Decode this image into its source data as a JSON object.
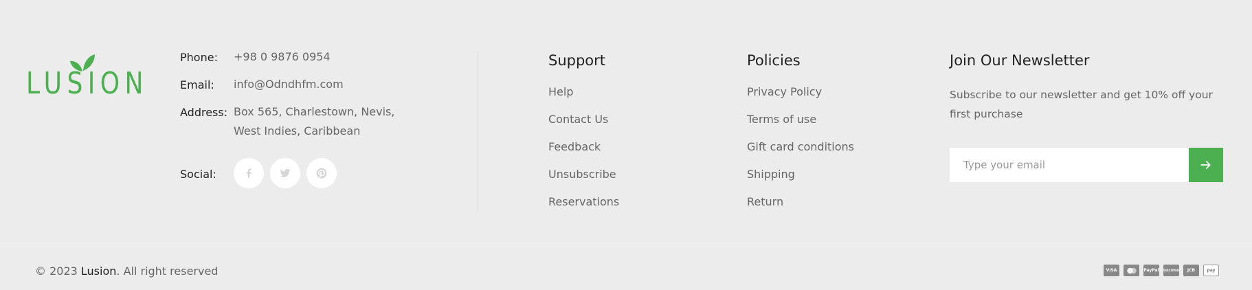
{
  "brand": {
    "logo_text": "LUSION",
    "logo_color": "#4caf50"
  },
  "contact": {
    "phone_label": "Phone:",
    "phone_value": "+98 0 9876 0954",
    "email_label": "Email:",
    "email_value": "info@Odndhfm.com",
    "address_label": "Address:",
    "address_line1": "Box 565, Charlestown, Nevis,",
    "address_line2": "West Indies, Caribbean",
    "social_label": "Social:",
    "social_icons": [
      "facebook-icon",
      "twitter-icon",
      "pinterest-icon"
    ]
  },
  "support": {
    "title": "Support",
    "links": [
      "Help",
      "Contact Us",
      "Feedback",
      "Unsubscribe",
      "Reservations"
    ]
  },
  "policies": {
    "title": "Policies",
    "links": [
      "Privacy Policy",
      "Terms of use",
      "Gift card conditions",
      "Shipping",
      "Return"
    ]
  },
  "newsletter": {
    "title": "Join Our Newsletter",
    "description": "Subscribe to our newsletter and get 10% off your first purchase",
    "input_placeholder": "Type your email",
    "submit_icon": "arrow-right-icon",
    "accent_color": "#4caf50"
  },
  "bottom": {
    "copyright_prefix": "© 2023",
    "copyright_brand": "Lusion",
    "copyright_suffix": ". All right reserved",
    "payment_methods": [
      {
        "name": "visa-icon",
        "label": "VISA"
      },
      {
        "name": "mastercard-icon",
        "label": ""
      },
      {
        "name": "paypal-icon",
        "label": "PayPal"
      },
      {
        "name": "discover-icon",
        "label": "DISCOVER"
      },
      {
        "name": "jcb-icon",
        "label": "JCB"
      },
      {
        "name": "amazon-pay-icon",
        "label": "pay"
      }
    ]
  },
  "colors": {
    "background": "#ececed",
    "accent": "#4caf50"
  }
}
